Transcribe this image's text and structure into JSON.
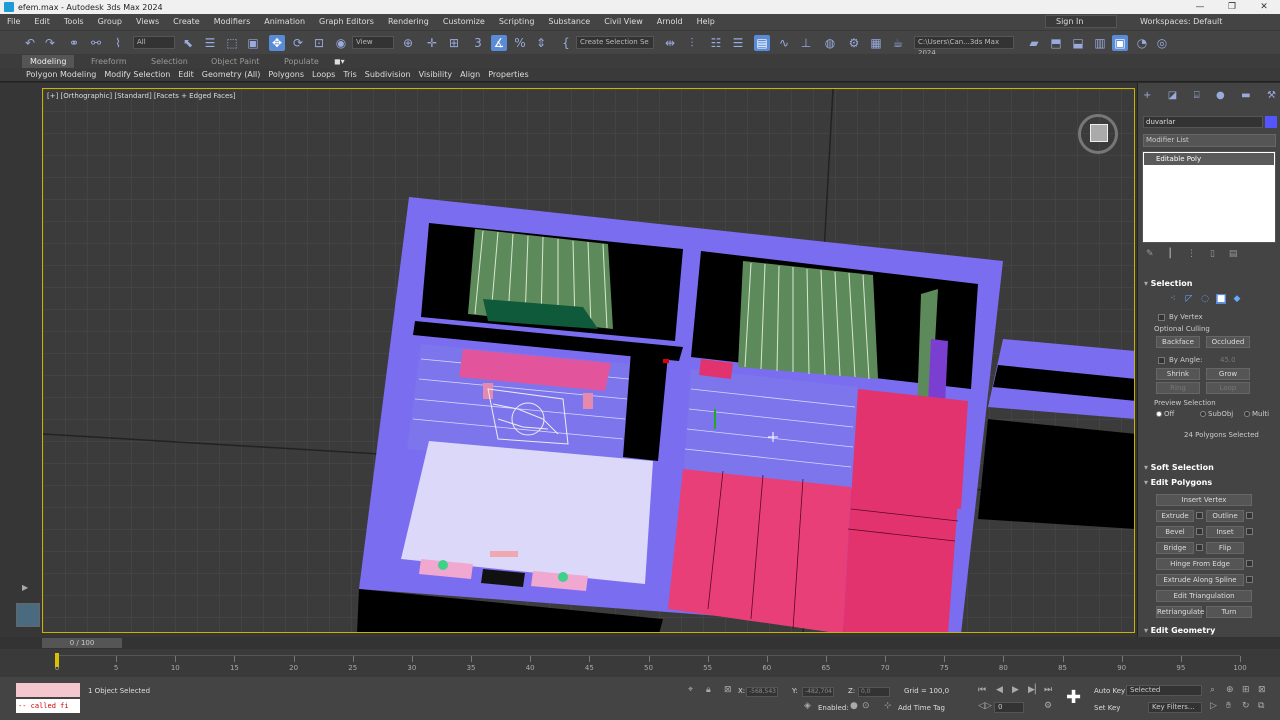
{
  "window": {
    "title": "efem.max - Autodesk 3ds Max 2024",
    "controls": [
      "—",
      "❐",
      "✕"
    ]
  },
  "menu": {
    "items": [
      "File",
      "Edit",
      "Tools",
      "Group",
      "Views",
      "Create",
      "Modifiers",
      "Animation",
      "Graph Editors",
      "Rendering",
      "Customize",
      "Scripting",
      "Substance",
      "Civil View",
      "Arnold",
      "Help"
    ],
    "sign_in": "Sign In",
    "workspaces_label": "Workspaces:",
    "workspace_value": "Default"
  },
  "toolbar": {
    "selection_filter": "All",
    "ref_coord": "View",
    "named_selection": "Create Selection Se",
    "project_path": "C:\\Users\\Can...3ds Max 2024"
  },
  "ribbon": {
    "tabs": [
      "Modeling",
      "Freeform",
      "Selection",
      "Object Paint",
      "Populate"
    ],
    "active_tab": "Modeling",
    "subtabs": [
      "Polygon Modeling",
      "Modify Selection",
      "Edit",
      "Geometry (All)",
      "Polygons",
      "Loops",
      "Tris",
      "Subdivision",
      "Visibility",
      "Align",
      "Properties"
    ]
  },
  "viewport": {
    "label": "[+] [Orthographic] [Standard] [Facets + Edged Faces]"
  },
  "command_panel": {
    "object_name": "duvarlar",
    "object_color": "#5555ff",
    "modifier_list": "Modifier List",
    "stack_item": "Editable Poly",
    "selection": {
      "title": "Selection",
      "by_vertex": "By Vertex",
      "optional_culling": "Optional Culling",
      "backface": "Backface",
      "occluded": "Occluded",
      "by_angle": "By Angle:",
      "angle_value": "45.0",
      "shrink": "Shrink",
      "grow": "Grow",
      "ring": "Ring",
      "loop": "Loop",
      "preview_selection": "Preview Selection",
      "preview_off": "Off",
      "preview_subobj": "SubObj",
      "preview_multi": "Multi",
      "status": "24 Polygons Selected"
    },
    "soft_selection": "Soft Selection",
    "edit_polygons": {
      "title": "Edit Polygons",
      "insert_vertex": "Insert Vertex",
      "extrude": "Extrude",
      "outline": "Outline",
      "bevel": "Bevel",
      "inset": "Inset",
      "bridge": "Bridge",
      "flip": "Flip",
      "hinge": "Hinge From Edge",
      "extrude_spline": "Extrude Along Spline",
      "edit_tri": "Edit Triangulation",
      "retriangulate": "Retriangulate",
      "turn": "Turn"
    },
    "edit_geometry": "Edit Geometry"
  },
  "timeline": {
    "slider_label": "0 / 100",
    "ticks": [
      0,
      5,
      10,
      15,
      20,
      25,
      30,
      35,
      40,
      45,
      50,
      55,
      60,
      65,
      70,
      75,
      80,
      85,
      90,
      95,
      100
    ]
  },
  "status": {
    "maxscript_text": "-- called fi",
    "selected": "1 Object Selected",
    "x_label": "X:",
    "x_value": "-568,543",
    "y_label": "Y:",
    "y_value": "-482,704",
    "z_label": "Z:",
    "z_value": "0,0",
    "grid": "Grid = 100,0",
    "enabled": "Enabled:",
    "add_time_tag": "Add Time Tag",
    "frame_value": "0",
    "auto_key": "Auto Key",
    "set_key": "Set Key",
    "key_mode": "Selected",
    "key_filters": "Key Filters..."
  }
}
